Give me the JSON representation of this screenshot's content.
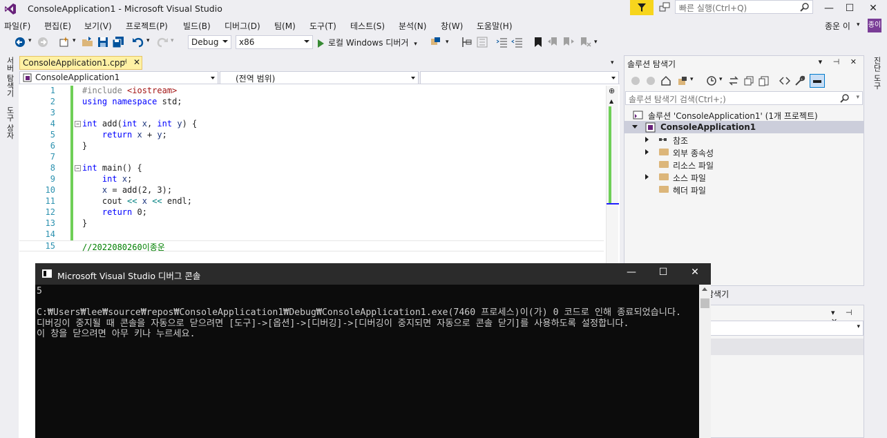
{
  "window": {
    "title": "ConsoleApplication1 - Microsoft Visual Studio",
    "quick_launch_placeholder": "빠른 실행(Ctrl+Q)",
    "user_name": "종운 이",
    "user_initials": "종이"
  },
  "menu": [
    "파일(F)",
    "편집(E)",
    "보기(V)",
    "프로젝트(P)",
    "빌드(B)",
    "디버그(D)",
    "팀(M)",
    "도구(T)",
    "테스트(S)",
    "분석(N)",
    "창(W)",
    "도움말(H)"
  ],
  "toolbar": {
    "configuration": "Debug",
    "platform": "x86",
    "start_label": "로컬 Windows 디버거"
  },
  "left_rail": [
    "서버 탐색기",
    "도구 상자"
  ],
  "right_rail": [
    "진단 도구"
  ],
  "editor": {
    "tab_label": "ConsoleApplication1.cpp",
    "tab_pin": "⊣",
    "tab_close": "✕",
    "nav_project": "ConsoleApplication1",
    "nav_scope": "(전역 범위)",
    "lines": [
      {
        "n": "1",
        "text": "#include <iostream>"
      },
      {
        "n": "2",
        "text": "using namespace std;"
      },
      {
        "n": "3",
        "text": ""
      },
      {
        "n": "4",
        "text": "int add(int x, int y) {"
      },
      {
        "n": "5",
        "text": "    return x + y;"
      },
      {
        "n": "6",
        "text": "}"
      },
      {
        "n": "7",
        "text": ""
      },
      {
        "n": "8",
        "text": "int main() {"
      },
      {
        "n": "9",
        "text": "    int x;"
      },
      {
        "n": "10",
        "text": "    x = add(2, 3);"
      },
      {
        "n": "11",
        "text": "    cout << x << endl;"
      },
      {
        "n": "12",
        "text": "    return 0;"
      },
      {
        "n": "13",
        "text": "}"
      },
      {
        "n": "14",
        "text": ""
      },
      {
        "n": "15",
        "text": "//2022080260이종운"
      }
    ]
  },
  "solution_explorer": {
    "title": "솔루션 탐색기",
    "search_placeholder": "솔루션 탐색기 검색(Ctrl+;)",
    "solution_label": "솔루션 'ConsoleApplication1' (1개 프로젝트)",
    "project_label": "ConsoleApplication1",
    "items": [
      "참조",
      "외부 종속성",
      "리소스 파일",
      "소스 파일",
      "헤더 파일"
    ]
  },
  "properties": {
    "tab_label": "탐색기"
  },
  "console": {
    "title": "Microsoft Visual Studio 디버그 콘솔",
    "output": "5\n\nC:₩Users₩lee₩source₩repos₩ConsoleApplication1₩Debug₩ConsoleApplication1.exe(7460 프로세스)이(가) 0 코드로 인해 종료되었습니다.\n디버깅이 중지될 때 콘솔을 자동으로 닫으려면 [도구]->[옵션]->[디버깅]->[디버깅이 중지되면 자동으로 콘솔 닫기]를 사용하도록 설정합니다.\n이 창을 닫으려면 아무 키나 누르세요."
  },
  "colors": {
    "accent": "#68217a",
    "change_bar": "#6fcf57",
    "selection": "#cccedb",
    "tab_active": "#fff1a4"
  }
}
